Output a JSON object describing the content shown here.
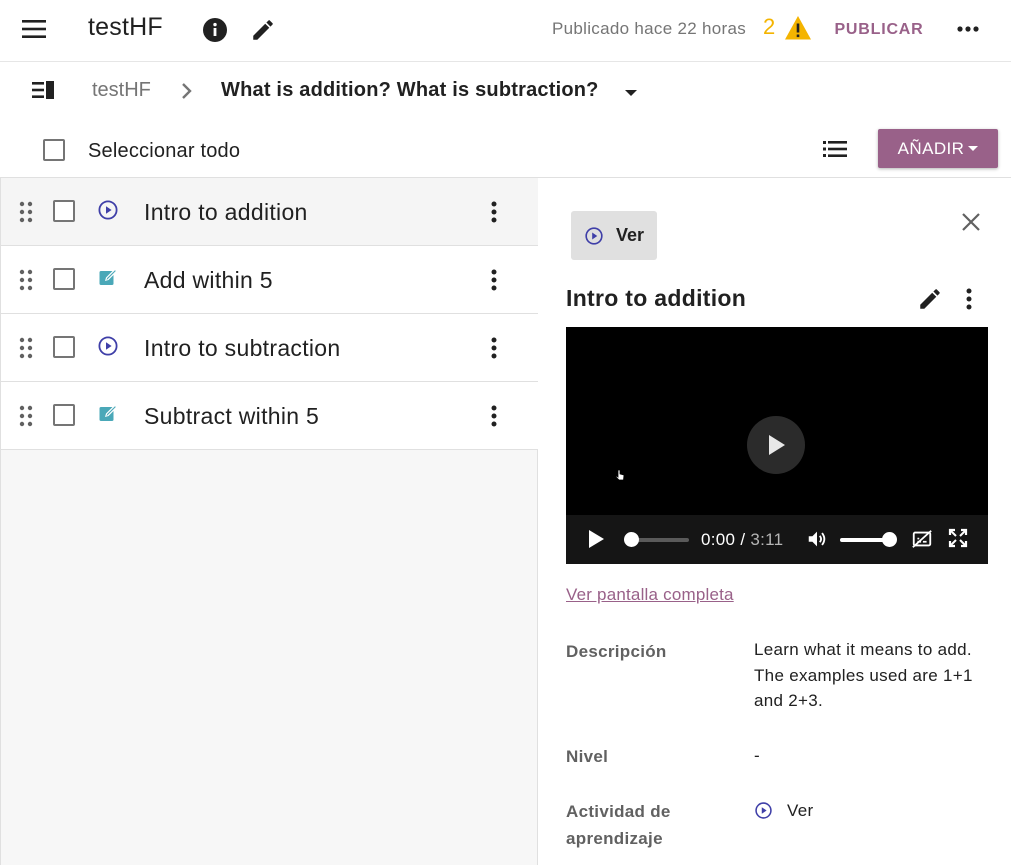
{
  "app": {
    "channel_title": "testHF",
    "published_status": "Publicado hace 22 horas",
    "warning_count": "2",
    "publish_label": "PUBLICAR"
  },
  "breadcrumb": {
    "root": "testHF",
    "current": "What is addition? What is subtraction?"
  },
  "toolbar": {
    "select_all_label": "Seleccionar todo",
    "add_label": "AÑADIR"
  },
  "nodes": [
    {
      "title": "Intro to addition",
      "kind": "video-icon"
    },
    {
      "title": "Add within 5",
      "kind": "exercise-icon"
    },
    {
      "title": "Intro to subtraction",
      "kind": "video-icon"
    },
    {
      "title": "Subtract within 5",
      "kind": "exercise-icon"
    }
  ],
  "details": {
    "kind_chip_label": "Ver",
    "title": "Intro to addition",
    "player": {
      "current_time": "0:00",
      "duration": "3:11",
      "progress_fraction": 0,
      "volume_fraction": 1
    },
    "fullscreen_link": "Ver pantalla completa",
    "description_label": "Descripción",
    "description_value": "Learn what it means to add. The examples used are 1+1 and 2+3.",
    "level_label": "Nivel",
    "level_value": "-",
    "activity_label": "Actividad de aprendizaje",
    "activity_value": "Ver"
  },
  "colors": {
    "brand": "#996189",
    "warning": "#f4b400",
    "video_icon": "#3f3fa8",
    "exercise_icon": "#4aa8b8"
  }
}
